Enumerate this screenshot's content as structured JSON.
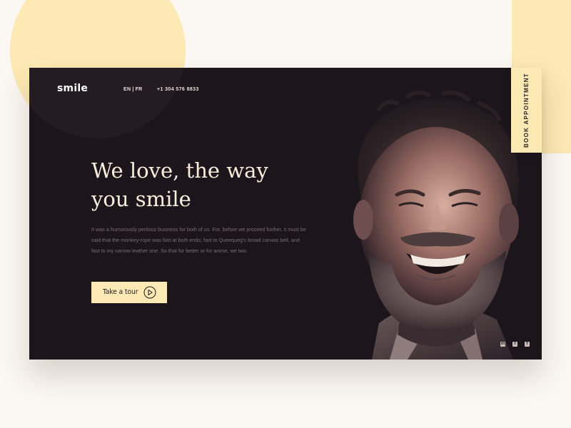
{
  "brand": {
    "logo": "smile"
  },
  "nav": {
    "lang_en": "EN",
    "lang_separator": "|",
    "lang_fr": "FR",
    "phone": "+1 304 576 8833"
  },
  "hero": {
    "headline_line1": "We love, the way",
    "headline_line2": "you smile",
    "body": "It was a humorously perilous business for both of us. For, before we proceed further, it must be said that the monkey-rope was fast at both ends; fast to Queequeg's broad canvas belt, and fast to my narrow leather one. So that for better or for worse, we two.",
    "cta_label": "Take a tour"
  },
  "side_tab": {
    "label": "BOOK APPOINTMENT"
  },
  "social": {
    "icons": [
      "linkedin-icon",
      "twitter-icon",
      "facebook-icon"
    ]
  },
  "colors": {
    "card_bg": "#1c161c",
    "accent": "#fde9b4",
    "page_bg": "#fbf7f2",
    "headline": "#fbeedd"
  }
}
